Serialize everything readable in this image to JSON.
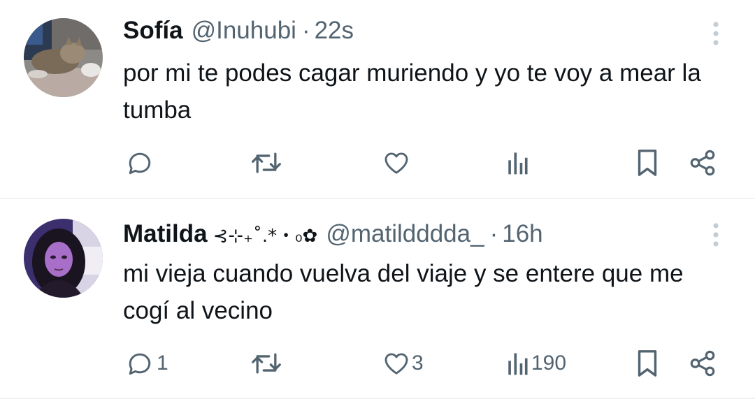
{
  "tweets": [
    {
      "display_name": "Sofía",
      "name_decoration": "",
      "handle": "@Inuhubi",
      "separator": "·",
      "time": "22s",
      "text": "por mi te podes cagar muriendo y yo te voy a mear la tumba",
      "avatar": "cat-avatar",
      "counts": {
        "replies": "",
        "retweets": "",
        "likes": "",
        "views": ""
      }
    },
    {
      "display_name": "Matilda",
      "name_decoration": "⊰⊹₊˚.*・₀✿",
      "handle": "@matildddda_",
      "separator": "·",
      "time": "16h",
      "text": "mi vieja cuando vuelva del viaje y se entere que me cogí al vecino",
      "avatar": "girl-avatar",
      "counts": {
        "replies": "1",
        "retweets": "",
        "likes": "3",
        "views": "190"
      }
    }
  ],
  "icons": {
    "reply": "reply-icon",
    "retweet": "retweet-icon",
    "like": "heart-icon",
    "views": "views-icon",
    "bookmark": "bookmark-icon",
    "share": "share-icon",
    "more": "more-vertical-icon"
  },
  "colors": {
    "text_primary": "#0f1419",
    "text_secondary": "#536471",
    "divider": "#eff3f4",
    "background": "#ffffff"
  }
}
